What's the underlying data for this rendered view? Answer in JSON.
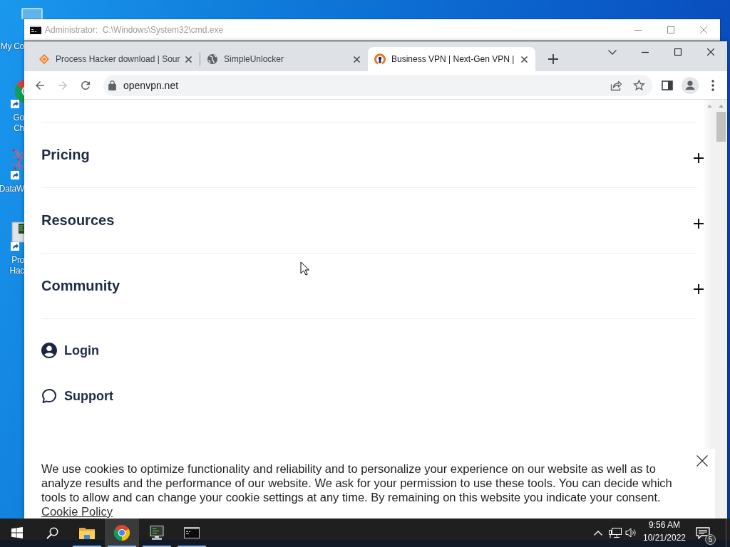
{
  "desktop": {
    "icons": [
      {
        "kind": "computer",
        "label_lines": [
          "My Co"
        ]
      },
      {
        "kind": "browser",
        "label_lines": [
          "Go",
          "Ch"
        ]
      },
      {
        "kind": "network",
        "label_lines": [
          "DataW"
        ]
      },
      {
        "kind": "monitor",
        "label_lines": [
          "Pro",
          "Hac"
        ]
      }
    ]
  },
  "cmd_window": {
    "title": "Administrator:  C:\\Windows\\System32\\cmd.exe"
  },
  "browser": {
    "tabs": [
      {
        "kind": "diamond",
        "title": "Process Hacker download | Sour",
        "selected": false
      },
      {
        "kind": "globe",
        "title": "SimpleUnlocker",
        "selected": false
      },
      {
        "kind": "keyhole",
        "title": "Business VPN | Next-Gen VPN |",
        "selected": true
      }
    ],
    "nav": [
      {
        "kind": "back",
        "disabled": false
      },
      {
        "kind": "forward",
        "disabled": true
      },
      {
        "kind": "reload",
        "disabled": false
      }
    ],
    "address": "openvpn.net"
  },
  "page": {
    "menu": [
      {
        "kind": "section",
        "label": "Pricing",
        "expanded": false
      },
      {
        "kind": "section",
        "label": "Resources",
        "expanded": false
      },
      {
        "kind": "section",
        "label": "Community",
        "expanded": false
      },
      {
        "kind": "account",
        "label": "Login"
      },
      {
        "kind": "chat",
        "label": "Support"
      }
    ],
    "cookie_banner": {
      "text": "We use cookies to optimize functionality and reliability and to personalize your experience on our website as well as to analyze results and the performance of our website. We ask for your permission to use these tools. You can decide which tools to allow and can change your cookie settings at any time. By remaining on this website you indicate your consent.",
      "link": "Cookie Policy"
    }
  },
  "taskbar": {
    "apps": [
      {
        "kind": "explorer",
        "running": true,
        "selected": false
      },
      {
        "kind": "browser",
        "running": true,
        "selected": true
      },
      {
        "kind": "monitor",
        "running": true,
        "selected": false
      },
      {
        "kind": "terminal",
        "running": true,
        "selected": false
      }
    ],
    "time": "9:56 AM",
    "date": "10/21/2022",
    "notification_count": "5"
  }
}
